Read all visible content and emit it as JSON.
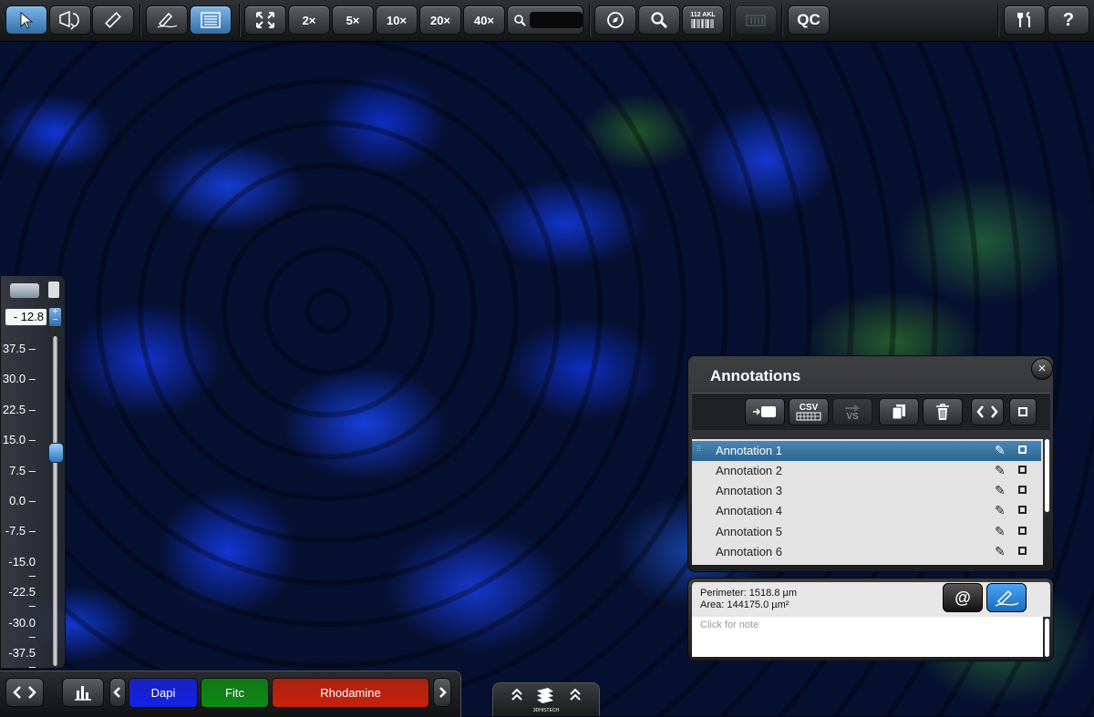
{
  "toolbar": {
    "zoom_buttons": [
      "2×",
      "5×",
      "10×",
      "20×",
      "40×"
    ],
    "barcode_label": "112 AKL",
    "qc_label": "QC",
    "help_label": "?"
  },
  "scale_panel": {
    "current_value": "- 12.8",
    "ticks": [
      "37.5 –",
      "30.0 –",
      "22.5 –",
      "15.0 –",
      "7.5 –",
      "0.0 –",
      "-7.5 –",
      "-15.0 –",
      "-22.5 –",
      "-30.0 –",
      "-37.5 –"
    ],
    "slider_value": 12.8,
    "slider_range": [
      -37.5,
      37.5
    ]
  },
  "annotations": {
    "title": "Annotations",
    "close_label": "×",
    "csv_label": "CSV",
    "vs_label": "VS",
    "items": [
      {
        "label": "Annotation 1",
        "selected": true
      },
      {
        "label": "Annotation 2",
        "selected": false
      },
      {
        "label": "Annotation 3",
        "selected": false
      },
      {
        "label": "Annotation 4",
        "selected": false
      },
      {
        "label": "Annotation 5",
        "selected": false
      },
      {
        "label": "Annotation 6",
        "selected": false
      }
    ]
  },
  "measurements": {
    "perimeter": "Perimeter: 1518.8 µm",
    "area": "Area: 144175.0 µm²",
    "at_label": "@"
  },
  "note": {
    "placeholder": "Click for note"
  },
  "channels": [
    {
      "label": "Dapi",
      "color": "#1522e6"
    },
    {
      "label": "Fitc",
      "color": "#0e8a14"
    },
    {
      "label": "Rhodamine",
      "color": "#c8220c"
    }
  ],
  "brand": {
    "label": "3DHISTECH"
  },
  "colors": {
    "accent": "#2f6ea8",
    "selection": "#2a6592"
  }
}
